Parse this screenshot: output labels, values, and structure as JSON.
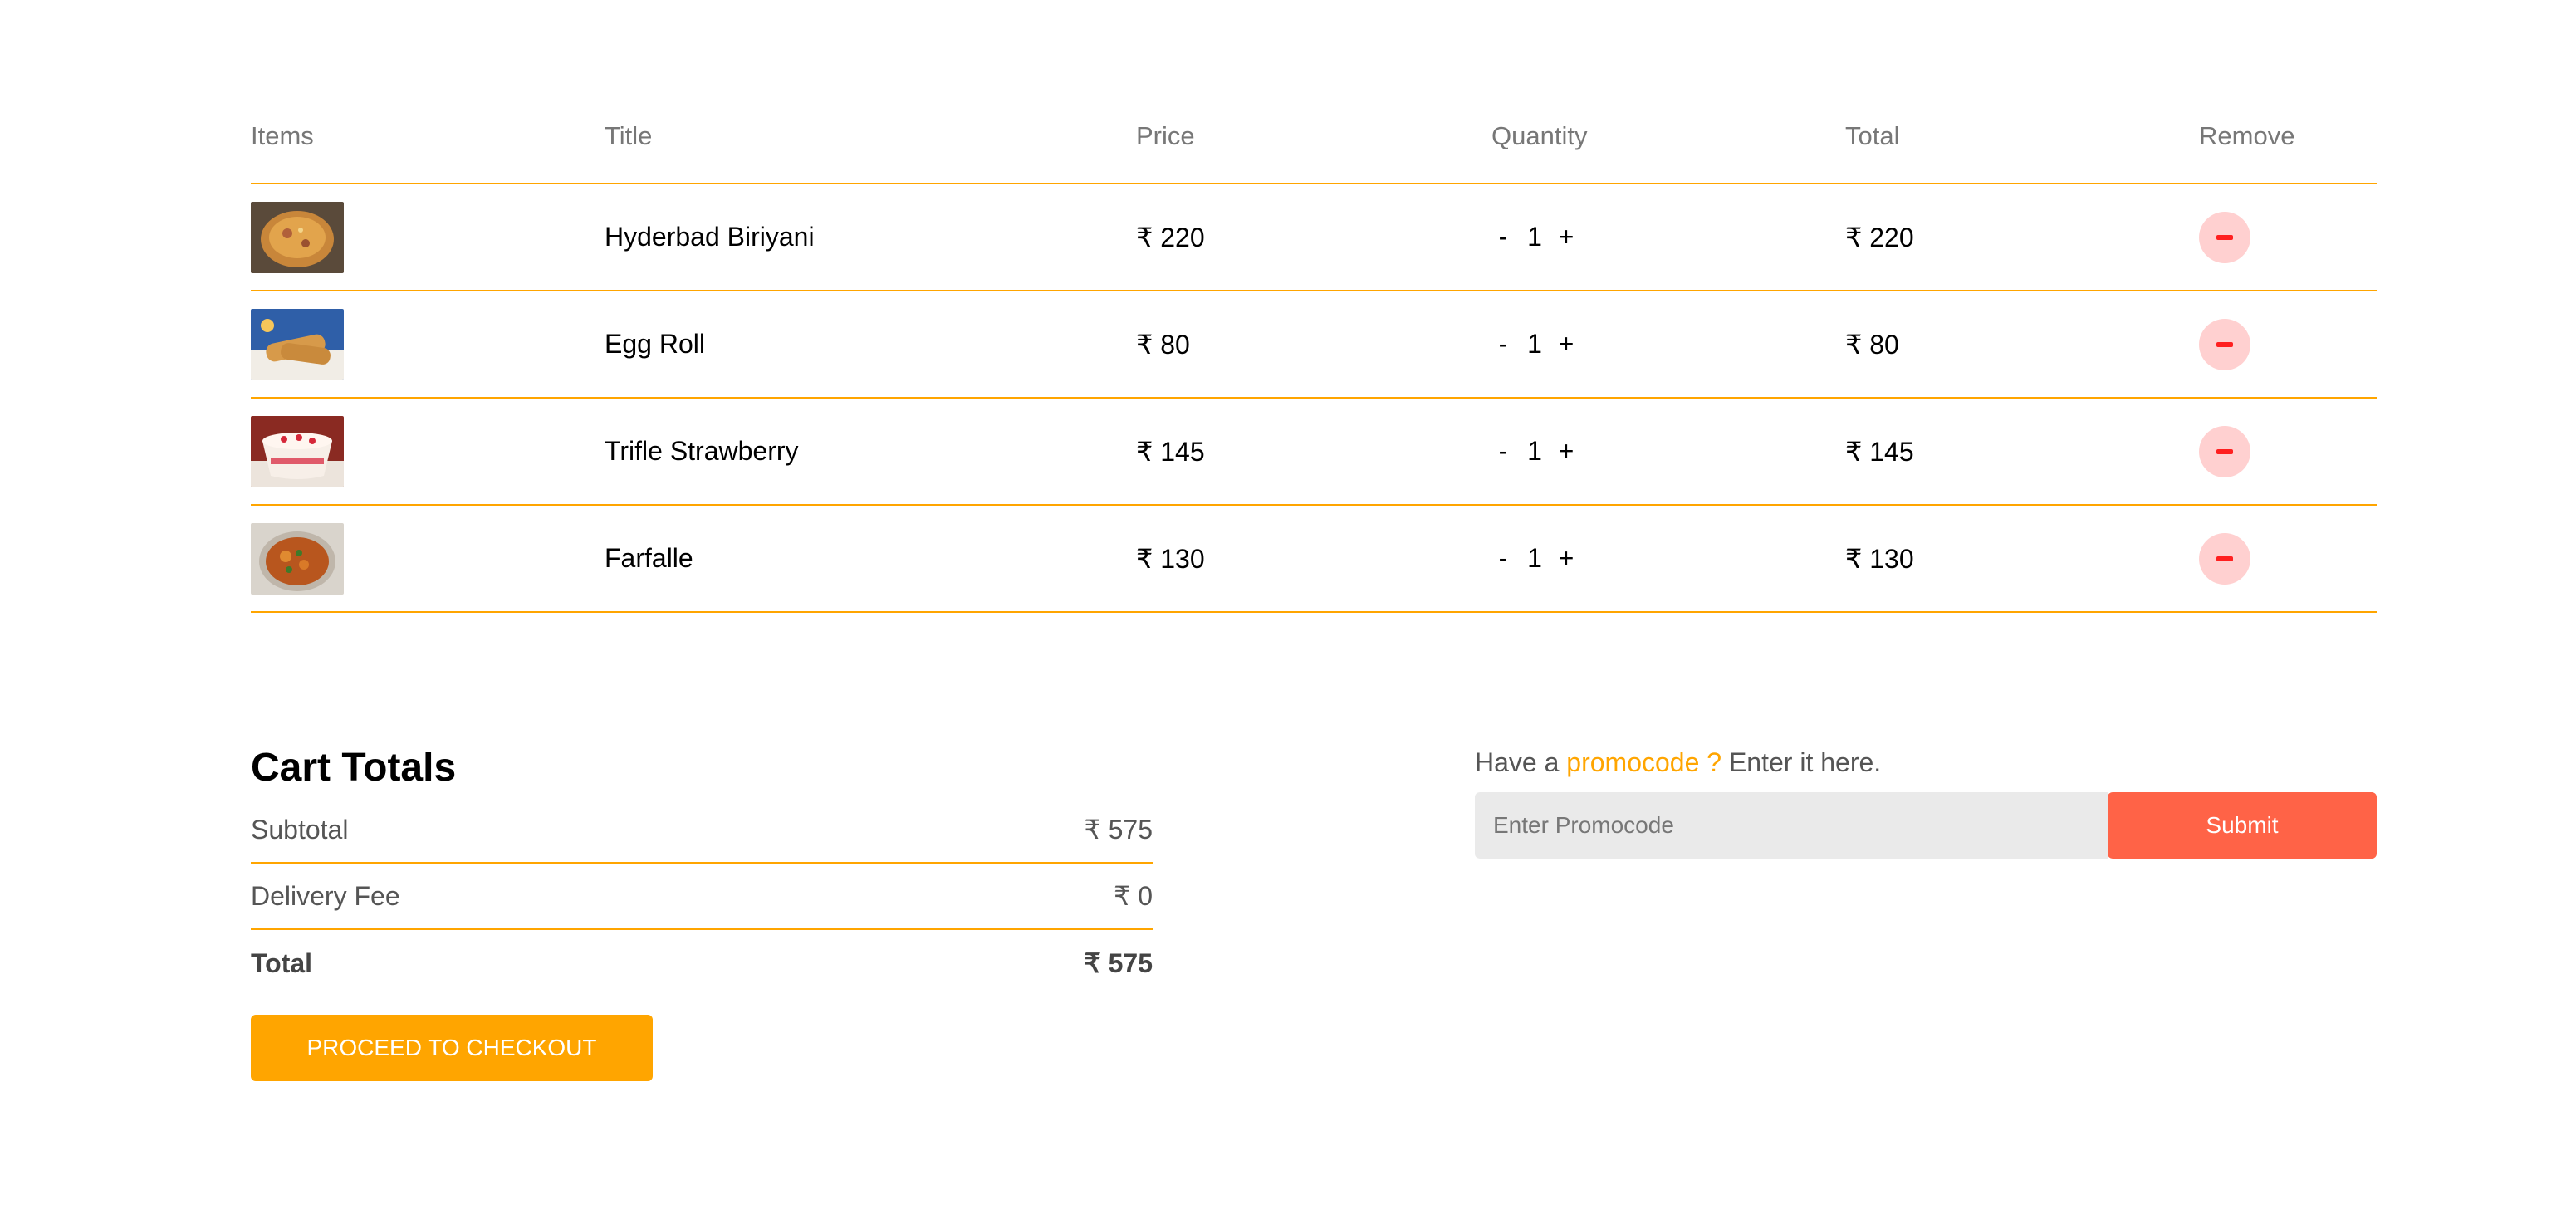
{
  "colors": {
    "accent": "#ffa500",
    "submit": "#ff6347",
    "remove_bg": "#ffd0d0",
    "remove_icon": "#ff2020"
  },
  "table": {
    "headers": {
      "items": "Items",
      "title": "Title",
      "price": "Price",
      "quantity": "Quantity",
      "total": "Total",
      "remove": "Remove"
    },
    "rows": [
      {
        "image_icon": "biryani-image",
        "title": "Hyderbad Biriyani",
        "price": "₹ 220",
        "minus": "-",
        "qty": "1",
        "plus": "+",
        "total": "₹ 220"
      },
      {
        "image_icon": "egg-roll-image",
        "title": "Egg Roll",
        "price": "₹ 80",
        "minus": "-",
        "qty": "1",
        "plus": "+",
        "total": "₹ 80"
      },
      {
        "image_icon": "trifle-image",
        "title": "Trifle Strawberry",
        "price": "₹ 145",
        "minus": "-",
        "qty": "1",
        "plus": "+",
        "total": "₹ 145"
      },
      {
        "image_icon": "farfalle-image",
        "title": "Farfalle",
        "price": "₹ 130",
        "minus": "-",
        "qty": "1",
        "plus": "+",
        "total": "₹ 130"
      }
    ]
  },
  "totals": {
    "heading": "Cart Totals",
    "subtotal_label": "Subtotal",
    "subtotal_value": "₹ 575",
    "delivery_label": "Delivery Fee",
    "delivery_value": "₹ 0",
    "total_label": "Total",
    "total_value": "₹ 575",
    "checkout_label": "PROCEED TO CHECKOUT"
  },
  "promo": {
    "text_before": "Have a ",
    "text_highlight": "promocode ?",
    "text_after": " Enter it here.",
    "placeholder": "Enter Promocode",
    "submit_label": "Submit"
  }
}
